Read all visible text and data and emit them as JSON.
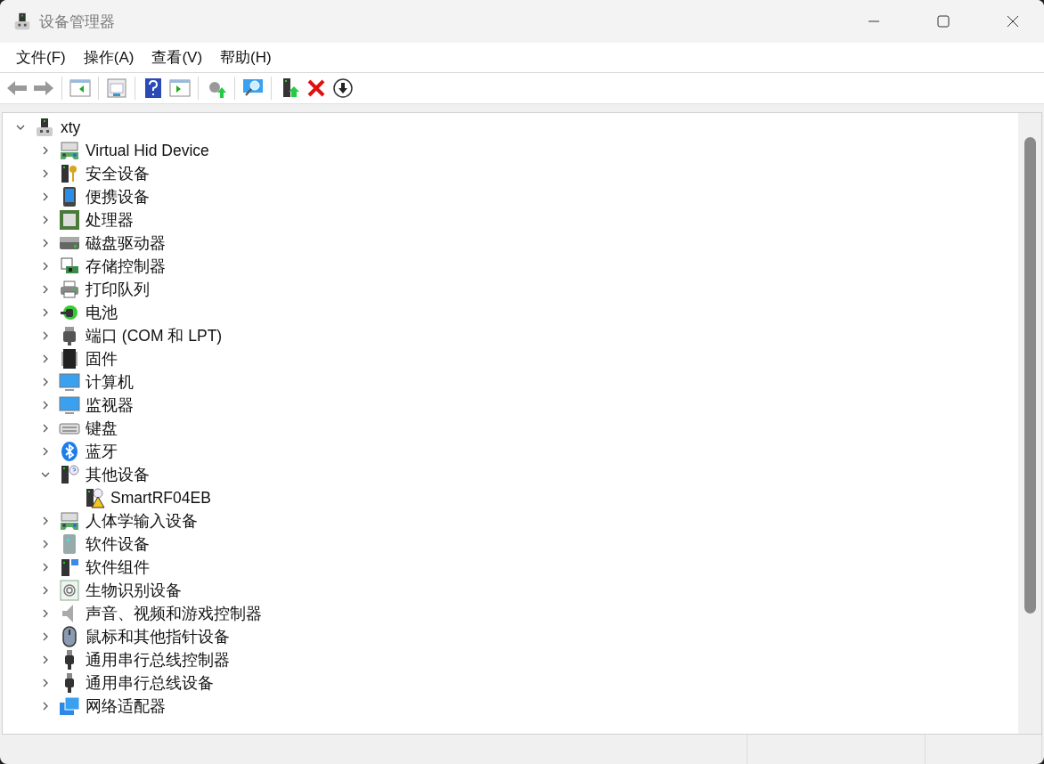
{
  "window": {
    "title": "设备管理器"
  },
  "menu": [
    "文件(F)",
    "操作(A)",
    "查看(V)",
    "帮助(H)"
  ],
  "tree": [
    {
      "label": "xty",
      "expanded": true,
      "children": [
        {
          "label": "Virtual Hid Device",
          "expanded": false
        },
        {
          "label": "安全设备",
          "expanded": false
        },
        {
          "label": "便携设备",
          "expanded": false
        },
        {
          "label": "处理器",
          "expanded": false
        },
        {
          "label": "磁盘驱动器",
          "expanded": false
        },
        {
          "label": "存储控制器",
          "expanded": false
        },
        {
          "label": "打印队列",
          "expanded": false
        },
        {
          "label": "电池",
          "expanded": false
        },
        {
          "label": "端口 (COM 和 LPT)",
          "expanded": false
        },
        {
          "label": "固件",
          "expanded": false
        },
        {
          "label": "计算机",
          "expanded": false
        },
        {
          "label": "监视器",
          "expanded": false
        },
        {
          "label": "键盘",
          "expanded": false
        },
        {
          "label": "蓝牙",
          "expanded": false
        },
        {
          "label": "其他设备",
          "expanded": true,
          "children": [
            {
              "label": "SmartRF04EB"
            }
          ]
        },
        {
          "label": "人体学输入设备",
          "expanded": false
        },
        {
          "label": "软件设备",
          "expanded": false
        },
        {
          "label": "软件组件",
          "expanded": false
        },
        {
          "label": "生物识别设备",
          "expanded": false
        },
        {
          "label": "声音、视频和游戏控制器",
          "expanded": false
        },
        {
          "label": "鼠标和其他指针设备",
          "expanded": false
        },
        {
          "label": "通用串行总线控制器",
          "expanded": false
        },
        {
          "label": "通用串行总线设备",
          "expanded": false
        },
        {
          "label": "网络适配器",
          "expanded": false
        }
      ]
    }
  ]
}
